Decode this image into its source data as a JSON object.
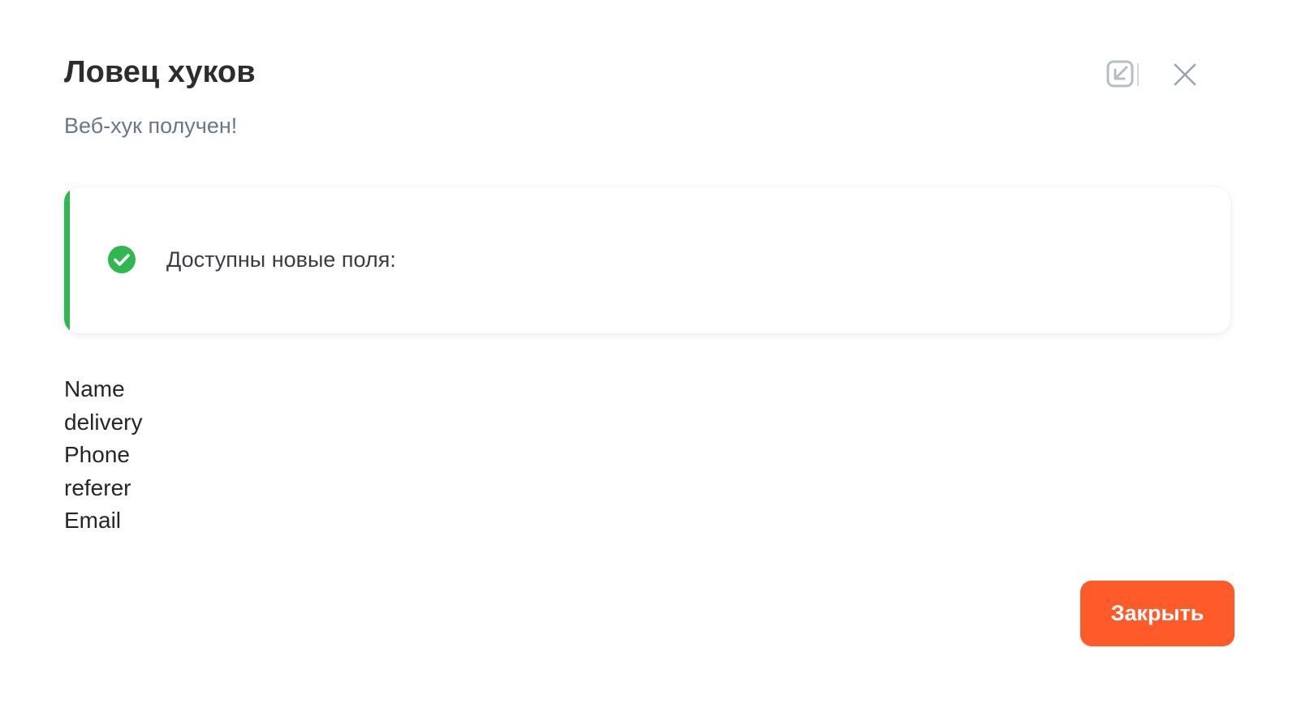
{
  "modal": {
    "title": "Ловец хуков",
    "subtitle": "Веб-хук получен!",
    "header_icons": [
      "minimize-icon",
      "close-icon"
    ],
    "notice": {
      "status": "success",
      "icon": "check-circle-icon",
      "text": "Доступны новые поля:",
      "accent_color": "#2fb84f"
    },
    "fields": [
      "Name",
      "delivery",
      "Phone",
      "referer",
      "Email"
    ],
    "close_button_label": "Закрыть",
    "button_color": "#ff5a2a"
  }
}
